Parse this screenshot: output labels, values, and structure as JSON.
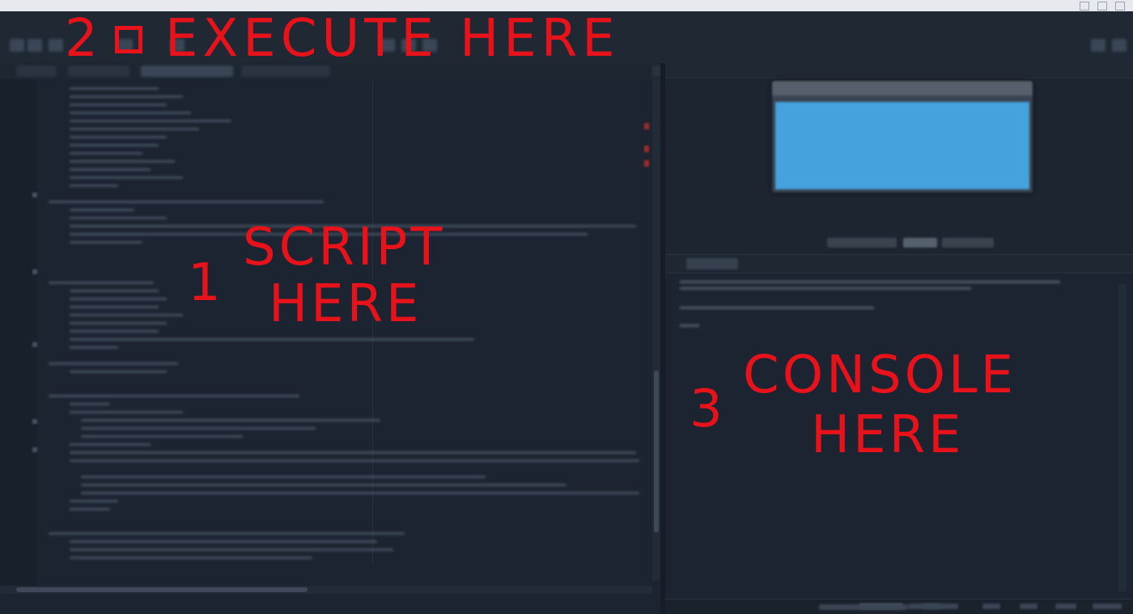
{
  "annotations": {
    "script": {
      "number": "1",
      "line1": "SCRIPT",
      "line2": "HERE"
    },
    "execute": {
      "number": "2",
      "text": "EXECUTE HERE"
    },
    "console": {
      "number": "3",
      "line1": "CONSOLE",
      "line2": "HERE"
    }
  },
  "colors": {
    "annotation": "#e8121b",
    "editor_bg": "#1b2430",
    "dialog_body": "#45a2dc"
  },
  "icons": [
    "run-icon",
    "toolbar-icon",
    "close-icon"
  ]
}
